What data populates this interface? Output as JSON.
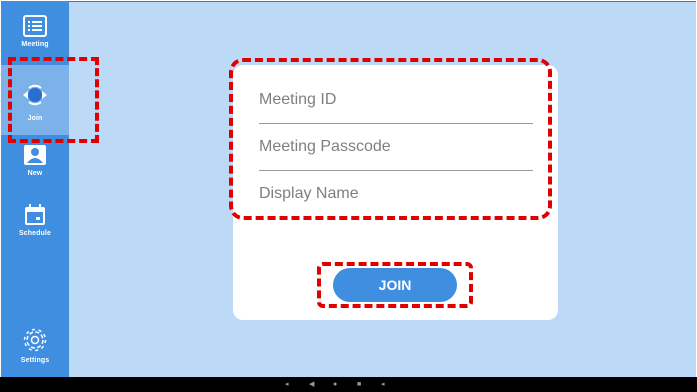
{
  "sidebar": {
    "items": [
      {
        "label": "Meeting",
        "icon": "list-icon"
      },
      {
        "label": "Join",
        "icon": "join-icon",
        "active": true
      },
      {
        "label": "New",
        "icon": "person-icon"
      },
      {
        "label": "Schedule",
        "icon": "calendar-icon"
      },
      {
        "label": "Settings",
        "icon": "gear-icon"
      }
    ]
  },
  "form": {
    "meeting_id_placeholder": "Meeting ID",
    "passcode_placeholder": "Meeting Passcode",
    "display_name_placeholder": "Display Name",
    "join_label": "JOIN"
  },
  "system_nav": {
    "volume_down": "◂",
    "back": "◀",
    "home": "●",
    "recents": "■",
    "volume_up": "◂"
  },
  "colors": {
    "background": "#bcd9f6",
    "sidebar": "#3f8ee0",
    "sidebar_active": "#7bb2ea",
    "accent": "#3f8ee0",
    "highlight": "#e00000"
  }
}
